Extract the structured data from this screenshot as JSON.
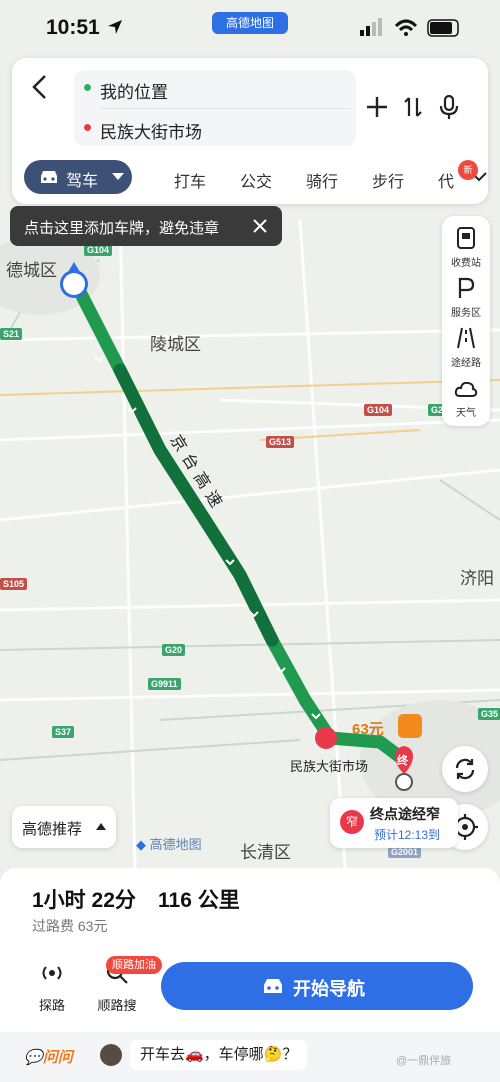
{
  "status_bar": {
    "time": "10:51",
    "app_label": "高德地图"
  },
  "route_input": {
    "from": "我的位置",
    "to": "民族大街市场"
  },
  "transport_modes": {
    "selected": "驾车",
    "others": [
      "打车",
      "公交",
      "骑行",
      "步行",
      "代"
    ],
    "new_badge": "新"
  },
  "tooltip": {
    "text": "点击这里添加车牌，避免违章"
  },
  "tools": [
    {
      "label": "收费站",
      "icon": "toll-station-icon"
    },
    {
      "label": "服务区",
      "icon": "service-area-icon"
    },
    {
      "label": "途经路",
      "icon": "road-icon"
    },
    {
      "label": "天气",
      "icon": "cloud-icon"
    }
  ],
  "map": {
    "places": [
      "德城区",
      "陵城区",
      "济阳",
      "长清区"
    ],
    "road_badges": [
      "G104",
      "G104",
      "G513",
      "G20",
      "G9911",
      "S37",
      "S105",
      "G35",
      "G2",
      "S21",
      "G2001"
    ],
    "highway_label": "京台高速",
    "destination_label": "民族大街市场",
    "end_marker": "终",
    "toll_price": "63元",
    "watermark": "高德地图",
    "colors": {
      "route": "#1f9a4e",
      "route_dark": "#12703a",
      "accent": "#2f6fe6"
    }
  },
  "recommend": {
    "label": "高德推荐"
  },
  "dest_chip": {
    "badge": "窄",
    "title": "终点途经窄",
    "subtitle": "预计12:13到"
  },
  "summary": {
    "duration": "1小时 22分",
    "distance": "116 公里",
    "toll": "过路费 63元"
  },
  "actions": {
    "explore": "探路",
    "along_search": "顺路搜",
    "along_badge": "顺路加油",
    "start": "开始导航"
  },
  "chat": {
    "brand": "问问",
    "message": "开车去🚗，车停哪🤔？",
    "watermark": "@一鼎伴旅"
  }
}
